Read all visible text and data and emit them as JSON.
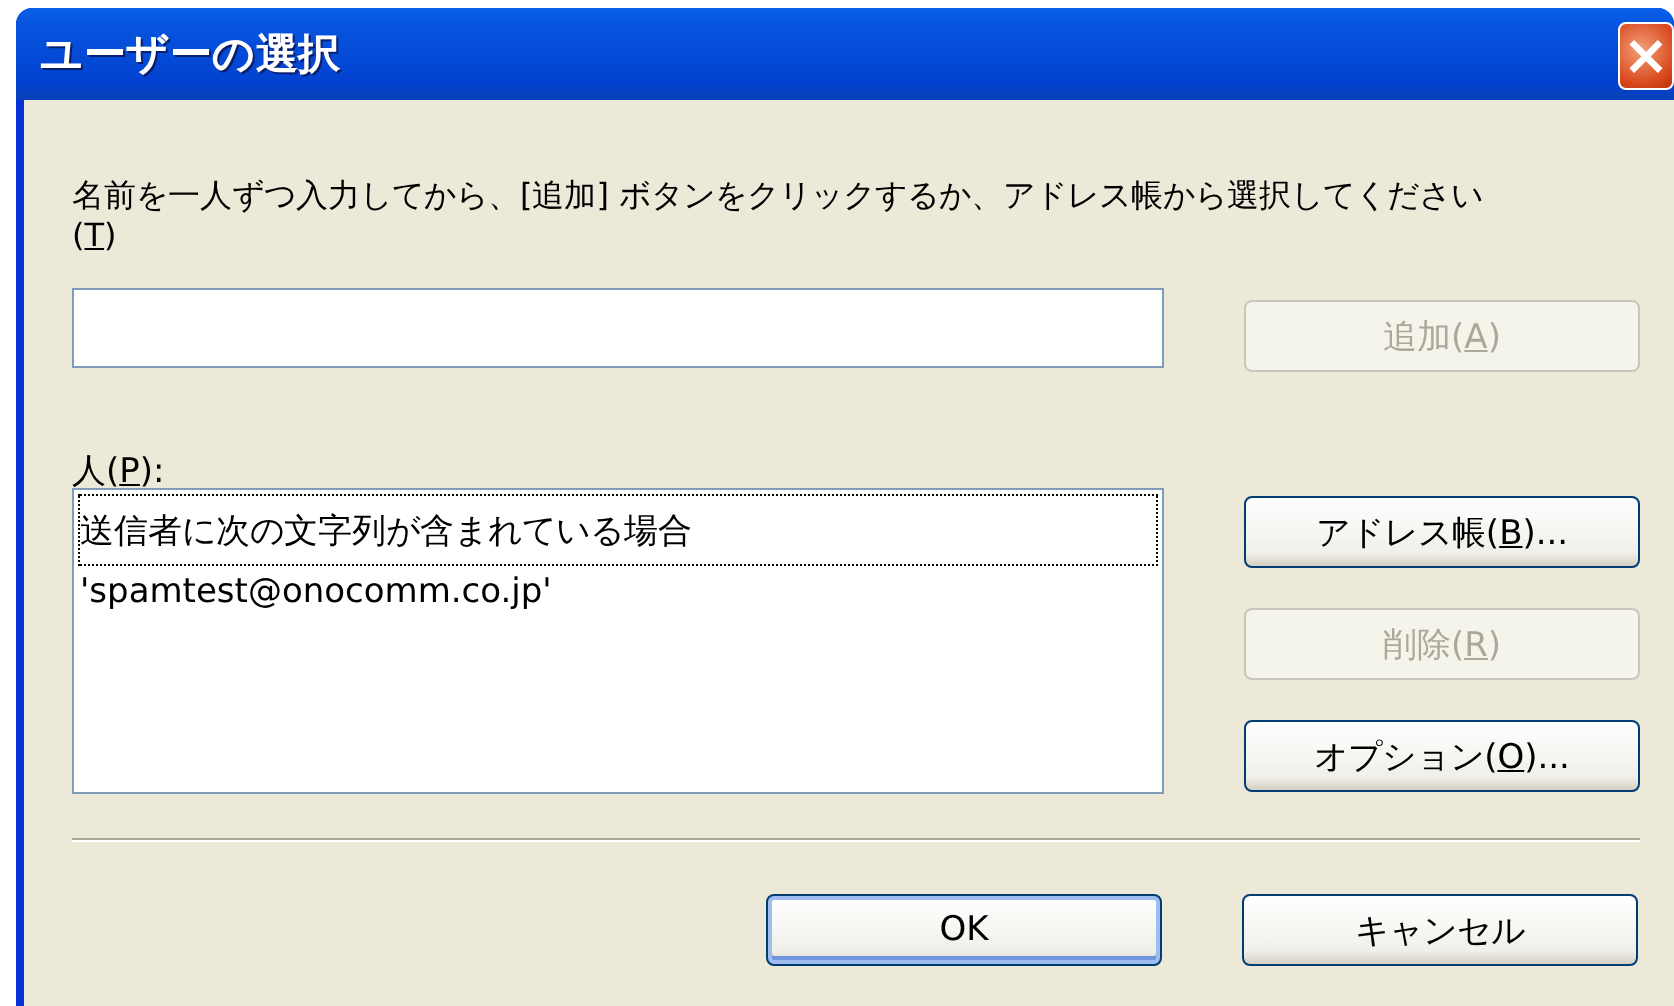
{
  "window": {
    "title": "ユーザーの選択",
    "close": "×"
  },
  "instruction": {
    "before": "名前を一人ずつ入力してから、[追加] ボタンをクリックするか、アドレス帳から選択してください(",
    "key": "T",
    "after": ")"
  },
  "add_button": {
    "before": "追加(",
    "key": "A",
    "after": ")",
    "disabled": true,
    "default": false
  },
  "people_label": {
    "before": "人(",
    "key": "P",
    "after": "):"
  },
  "people": [
    {
      "text": "送信者に次の文字列が含まれている場合",
      "focused": true
    },
    {
      "text": "'spamtest@onocomm.co.jp'",
      "focused": false
    }
  ],
  "side_buttons": [
    {
      "before": "アドレス帳(",
      "key": "B",
      "after": ")...",
      "disabled": false,
      "default": false
    },
    {
      "before": "削除(",
      "key": "R",
      "after": ")",
      "disabled": true,
      "default": false
    },
    {
      "before": "オプション(",
      "key": "O",
      "after": ")...",
      "disabled": false,
      "default": false
    }
  ],
  "footer_buttons": [
    {
      "after": "OK",
      "disabled": false,
      "default": true
    },
    {
      "after": "キャンセル",
      "disabled": false,
      "default": false
    }
  ]
}
